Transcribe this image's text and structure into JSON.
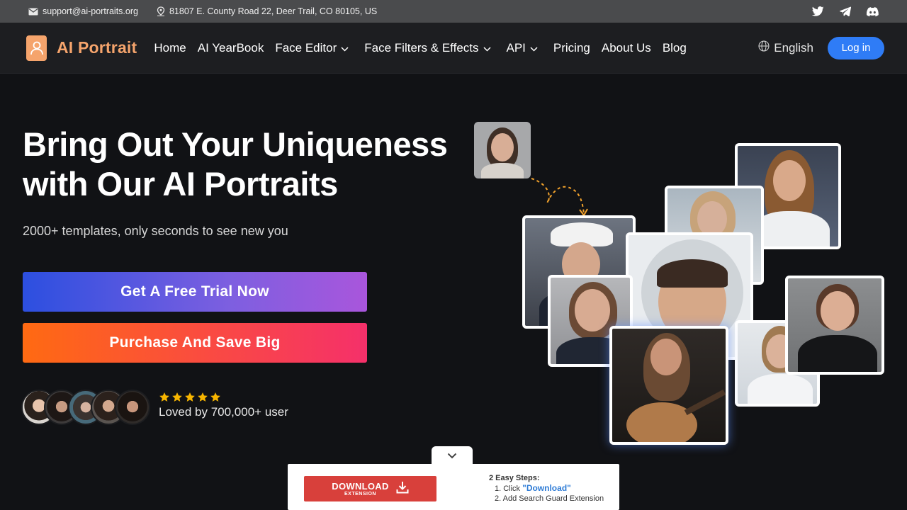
{
  "topbar": {
    "email": "support@ai-portraits.org",
    "address": "81807 E. County Road 22, Deer Trail, CO 80105, US",
    "socials": [
      "twitter-icon",
      "telegram-icon",
      "discord-icon"
    ]
  },
  "nav": {
    "logo": "AI Portrait",
    "items": [
      {
        "label": "Home",
        "dropdown": false
      },
      {
        "label": "AI YearBook",
        "dropdown": false
      },
      {
        "label": "Face Editor",
        "dropdown": true
      },
      {
        "label": "Face Filters & Effects",
        "dropdown": true
      },
      {
        "label": "API",
        "dropdown": true
      },
      {
        "label": "Pricing",
        "dropdown": false
      },
      {
        "label": "About Us",
        "dropdown": false
      },
      {
        "label": "Blog",
        "dropdown": false
      }
    ],
    "language": "English",
    "login": "Log in"
  },
  "hero": {
    "title_line1": "Bring Out Your Uniqueness",
    "title_line2": "with Our AI Portraits",
    "subtitle": "2000+ templates, only seconds to see new you",
    "cta_trial": "Get A Free Trial Now",
    "cta_purchase": "Purchase And Save Big",
    "rating_stars": 5,
    "loved_text": "Loved by 700,000+ user"
  },
  "download_bar": {
    "button_main": "DOWNLOAD",
    "button_sub": "EXTENSION",
    "steps_title": "2 Easy Steps:",
    "step1_prefix": "1. Click ",
    "step1_keyword": "\"Download\"",
    "step2": "2. Add Search Guard Extension"
  },
  "colors": {
    "brand_orange": "#f5a46c",
    "login_blue": "#2f7cf6",
    "download_red": "#d8403b"
  }
}
